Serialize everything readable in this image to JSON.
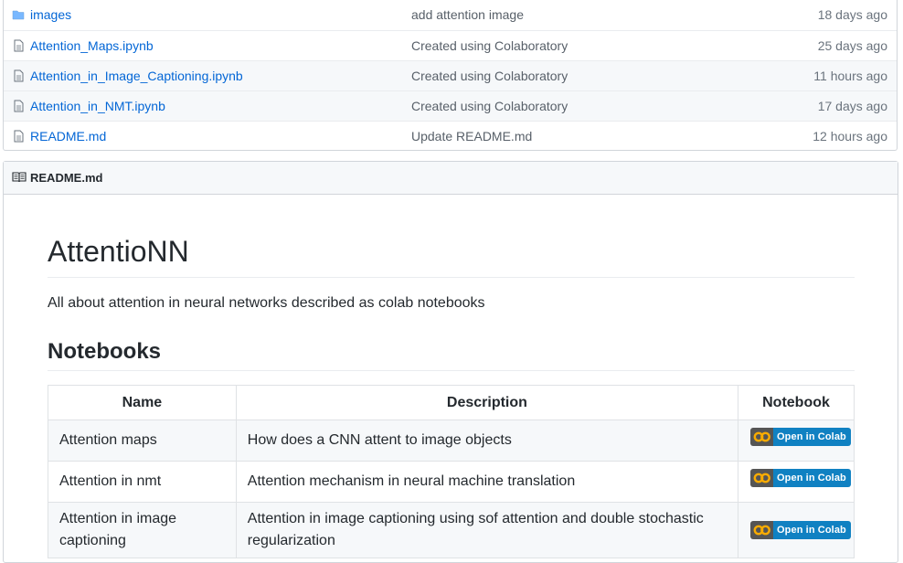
{
  "files": [
    {
      "icon": "folder-icon",
      "name": "images",
      "message": "add attention image",
      "age": "18 days ago"
    },
    {
      "icon": "file-icon",
      "name": "Attention_Maps.ipynb",
      "message": "Created using Colaboratory",
      "age": "25 days ago"
    },
    {
      "icon": "file-icon",
      "name": "Attention_in_Image_Captioning.ipynb",
      "message": "Created using Colaboratory",
      "age": "11 hours ago"
    },
    {
      "icon": "file-icon",
      "name": "Attention_in_NMT.ipynb",
      "message": "Created using Colaboratory",
      "age": "17 days ago"
    },
    {
      "icon": "file-icon",
      "name": "README.md",
      "message": "Update README.md",
      "age": "12 hours ago"
    }
  ],
  "readme": {
    "header_title": "README.md",
    "title": "AttentioNN",
    "description": "All about attention in neural networks described as colab notebooks",
    "section_heading": "Notebooks",
    "table": {
      "headers": [
        "Name",
        "Description",
        "Notebook"
      ],
      "rows": [
        {
          "name": "Attention maps",
          "description": "How does a CNN attent to image objects",
          "badge": "Open in Colab"
        },
        {
          "name": "Attention in nmt",
          "description": "Attention mechanism in neural machine translation",
          "badge": "Open in Colab"
        },
        {
          "name": "Attention in image captioning",
          "description": "Attention in image captioning using sof attention and double stochastic regularization",
          "badge": "Open in Colab"
        }
      ]
    }
  },
  "colors": {
    "link": "#0366d6",
    "badge_blue": "#1081c2",
    "badge_gray": "#555555",
    "colab_orange": "#f9ab00"
  }
}
